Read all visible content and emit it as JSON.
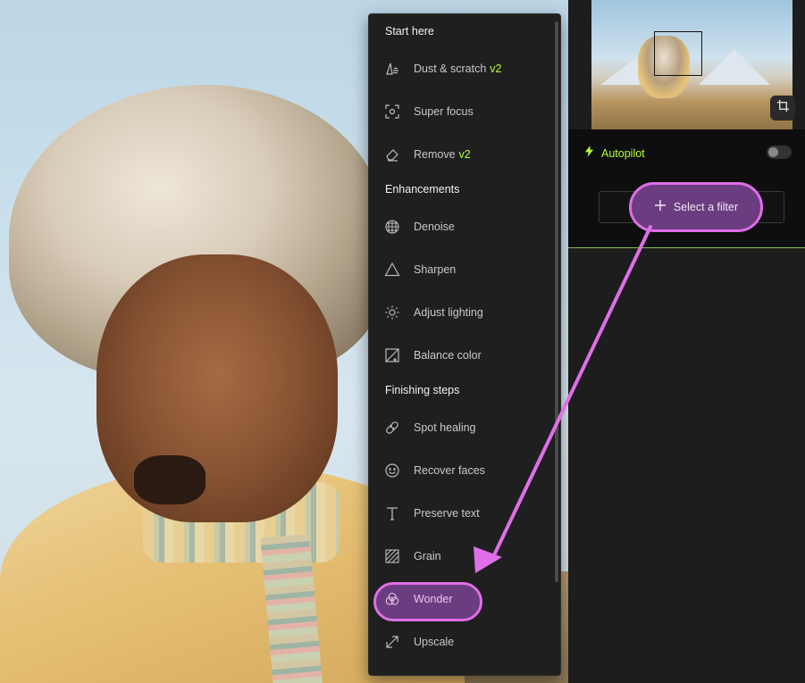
{
  "menu": {
    "sections": {
      "start_here": "Start here",
      "enhancements": "Enhancements",
      "finishing_steps": "Finishing steps"
    },
    "items": [
      {
        "label": "Dust & scratch",
        "badge": "v2",
        "icon": "dust-scratch-icon"
      },
      {
        "label": "Super focus",
        "icon": "focus-frame-icon"
      },
      {
        "label": "Remove",
        "badge": "v2",
        "icon": "eraser-icon"
      },
      {
        "label": "Denoise",
        "icon": "grid-circle-icon"
      },
      {
        "label": "Sharpen",
        "icon": "triangle-icon"
      },
      {
        "label": "Adjust lighting",
        "icon": "sun-icon"
      },
      {
        "label": "Balance color",
        "icon": "balance-square-icon"
      },
      {
        "label": "Spot healing",
        "icon": "bandage-icon"
      },
      {
        "label": "Recover faces",
        "icon": "smiley-icon"
      },
      {
        "label": "Preserve text",
        "icon": "text-t-icon"
      },
      {
        "label": "Grain",
        "icon": "hatched-square-icon"
      },
      {
        "label": "Wonder",
        "icon": "three-circles-icon"
      },
      {
        "label": "Upscale",
        "icon": "diagonal-arrows-icon"
      }
    ]
  },
  "panel": {
    "autopilot_label": "Autopilot",
    "autopilot_enabled": false,
    "select_filter_label": "Select a filter"
  },
  "colors": {
    "accent_green": "#b6ff3b",
    "highlight_purple": "#6b3c7f",
    "highlight_outline": "#e06ee8"
  }
}
